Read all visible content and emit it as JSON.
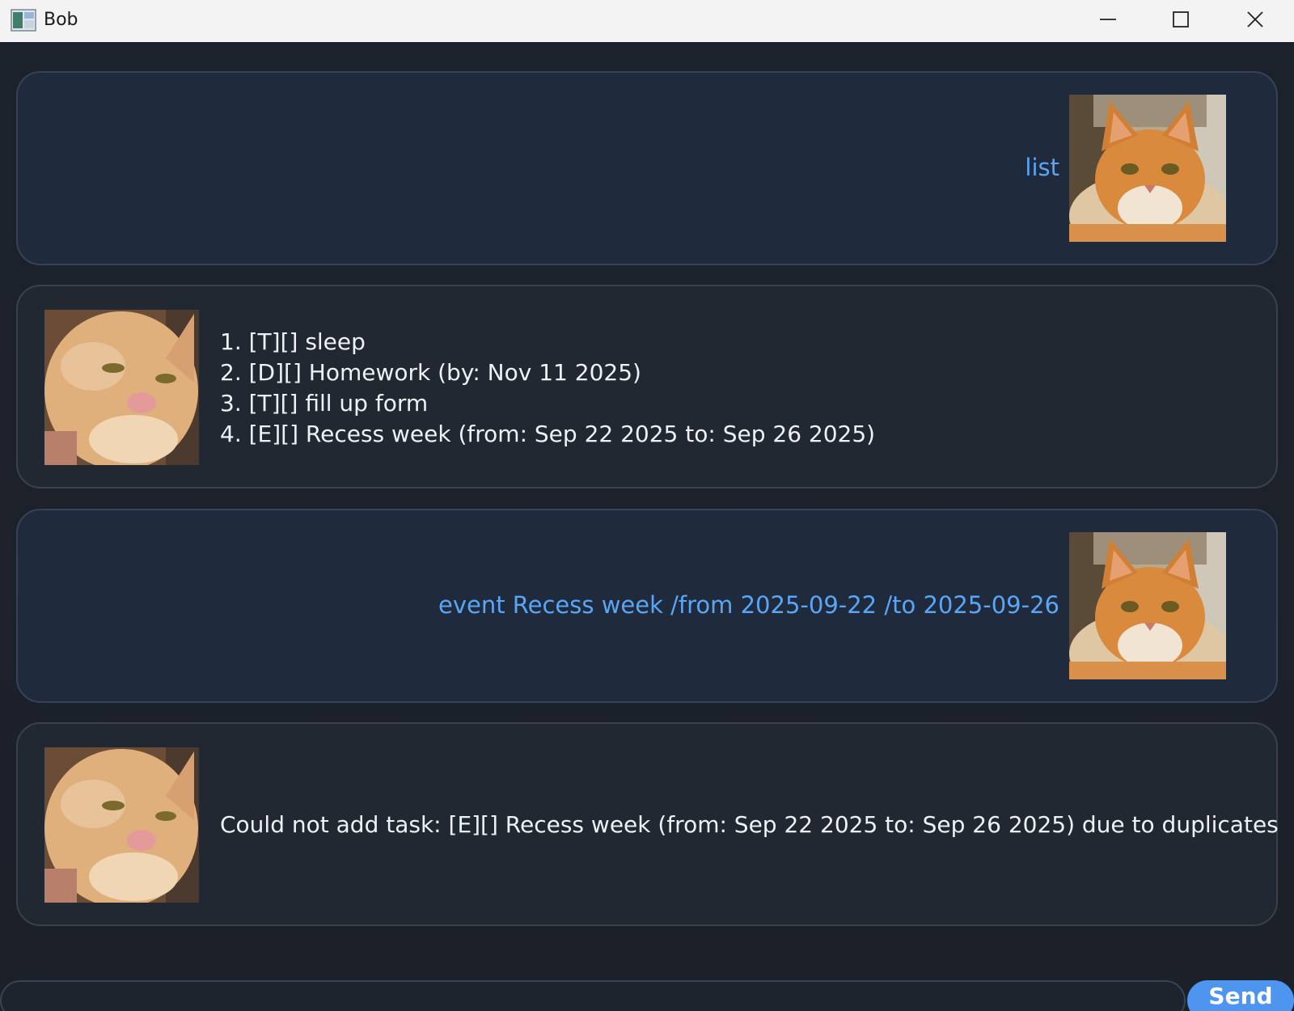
{
  "window": {
    "title": "Bob",
    "icon": "app-window-icon",
    "controls": [
      "minimize-icon",
      "maximize-icon",
      "close-icon"
    ]
  },
  "messages": [
    {
      "sender": "user",
      "text": "list",
      "avatar": "orange-cat-portrait"
    },
    {
      "sender": "bot",
      "lines": [
        "1. [T][] sleep",
        "2. [D][] Homework (by: Nov 11 2025)",
        "3. [T][] fill up form",
        "4. [E][] Recess week (from: Sep 22 2025 to: Sep 26 2025)"
      ],
      "avatar": "ginger-cat-closeup"
    },
    {
      "sender": "user",
      "text": "event Recess week /from 2025-09-22 /to 2025-09-26",
      "avatar": "orange-cat-portrait"
    },
    {
      "sender": "bot",
      "lines": [
        "Could not add task: [E][] Recess week (from: Sep 22 2025 to: Sep 26 2025) due to duplicates"
      ],
      "avatar": "ginger-cat-closeup"
    }
  ],
  "input": {
    "value": "",
    "placeholder": ""
  },
  "send_button": {
    "label": "Send"
  },
  "colors": {
    "user_text": "#5aa6f5",
    "bot_text": "#eef1f5",
    "send_button": "#4e95f0",
    "user_bubble": "#1f2a3c",
    "bot_bubble": "#222831"
  }
}
